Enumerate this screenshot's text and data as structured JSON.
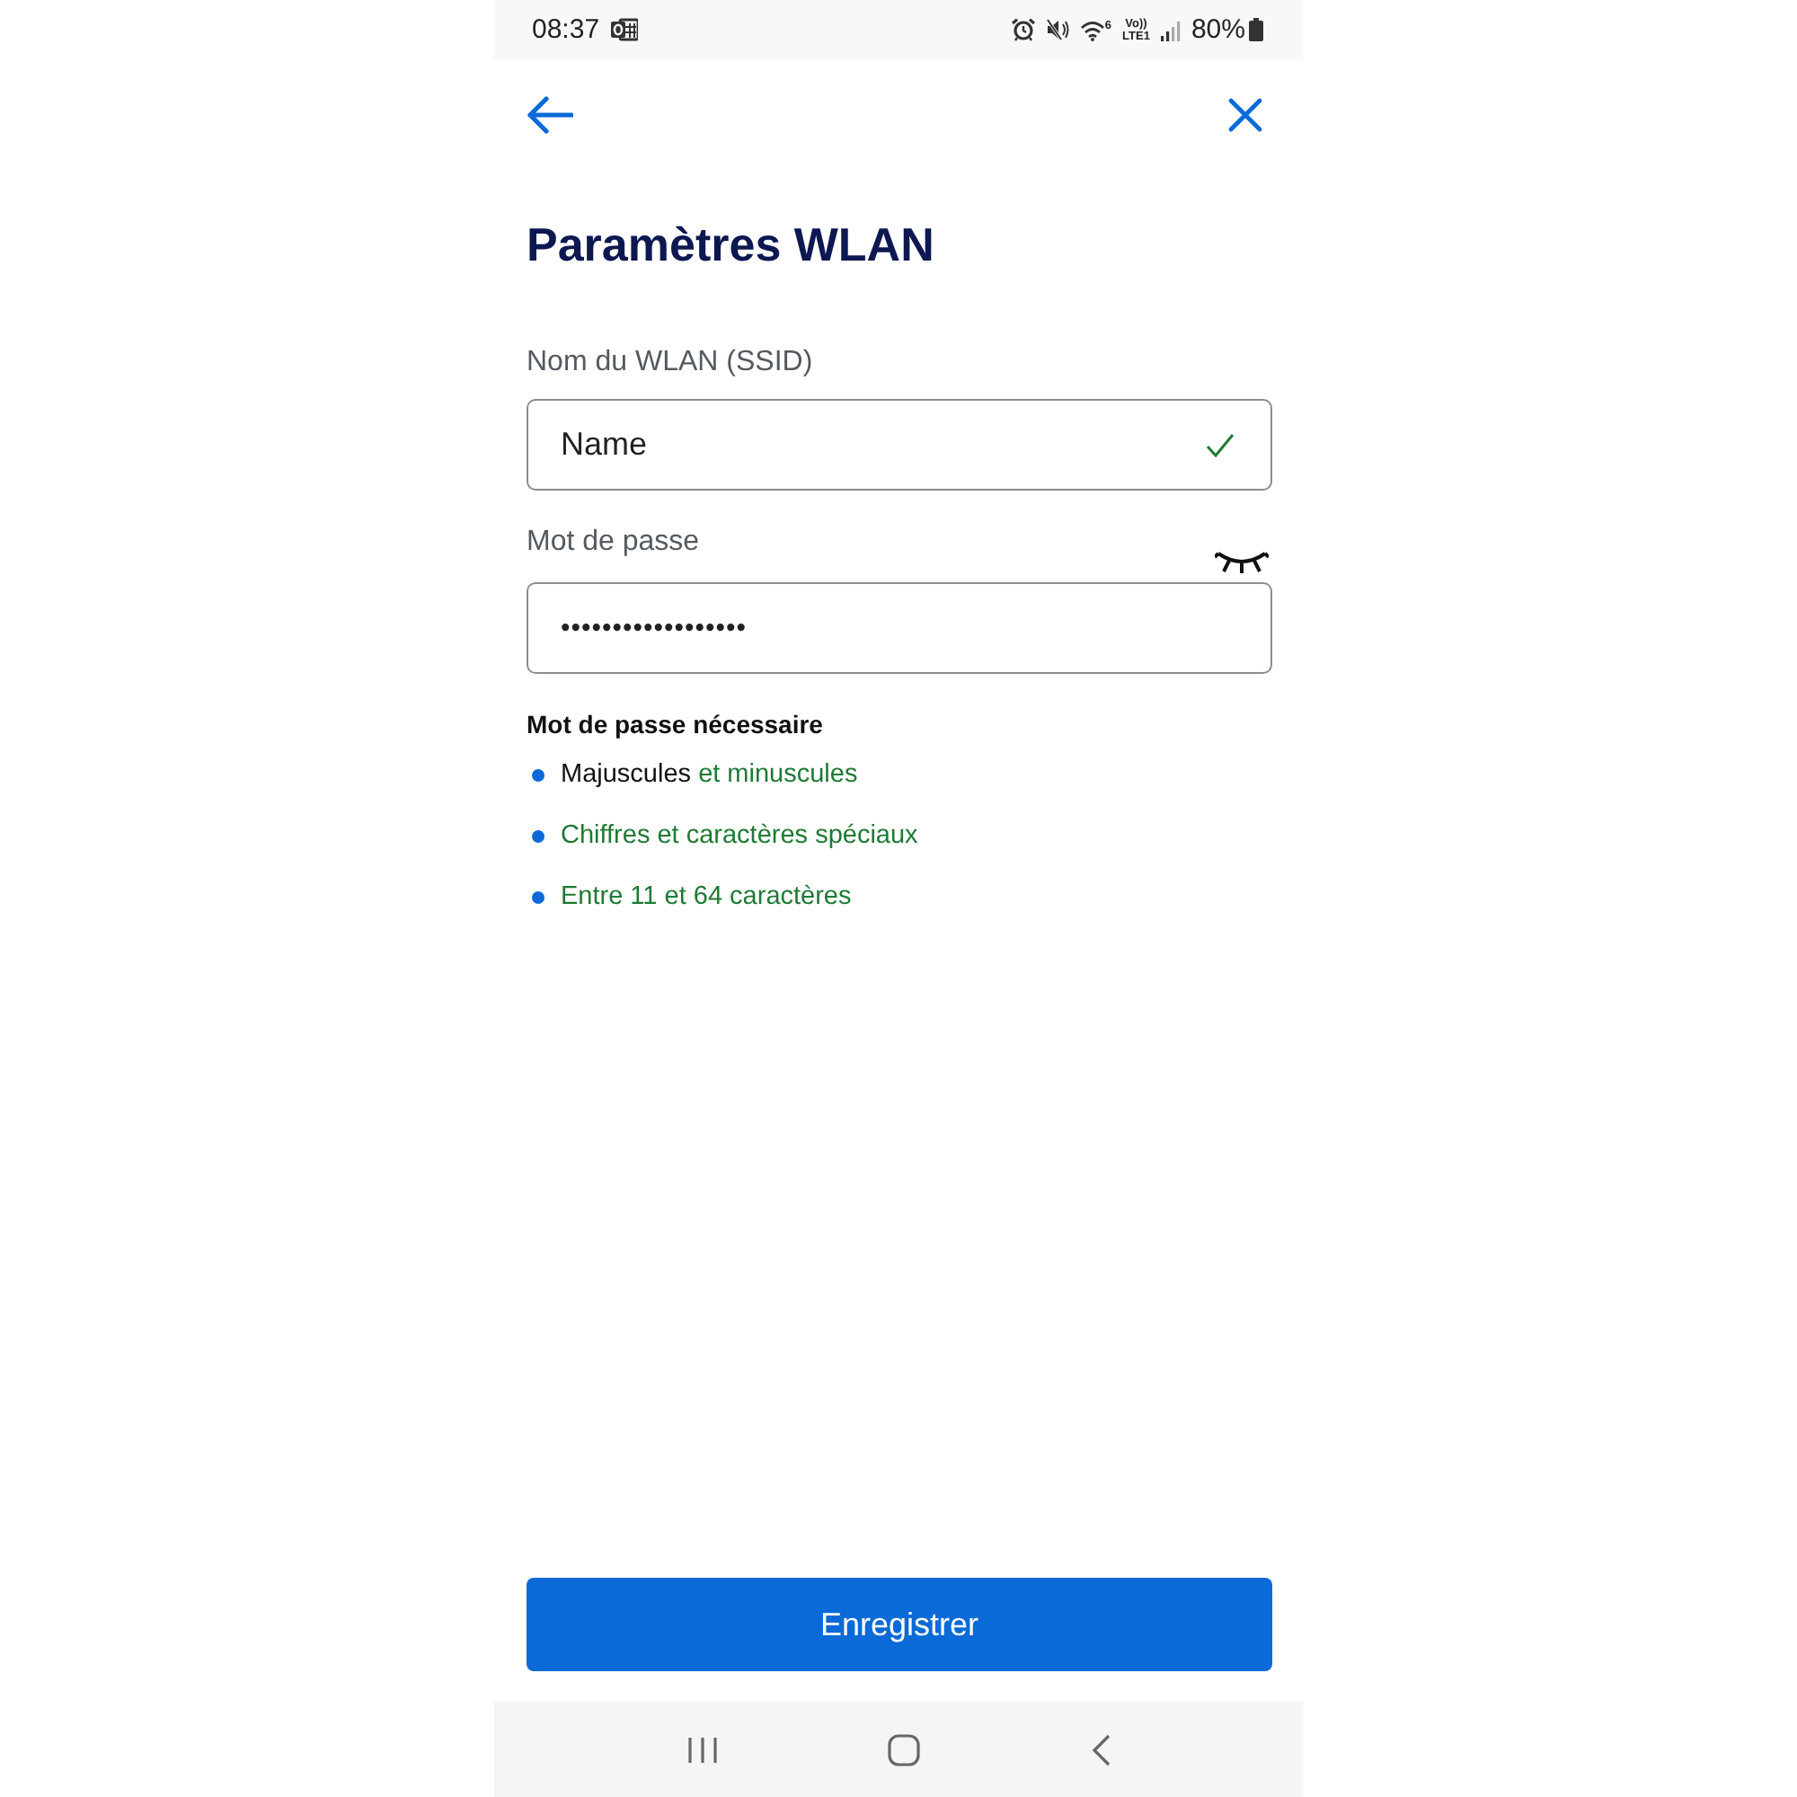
{
  "status_bar": {
    "time": "08:37",
    "wifi_label": "6",
    "network_top": "Vo))",
    "network_bottom": "LTE1",
    "battery": "80%"
  },
  "title": "Paramètres WLAN",
  "fields": [
    {
      "kind": "text",
      "label": "Nom du WLAN (SSID)",
      "value": "Name",
      "valid": true
    },
    {
      "kind": "password",
      "label": "Mot de passe",
      "value": "••••••••••••••••••",
      "valid": false
    }
  ],
  "requirements": {
    "title": "Mot de passe nécessaire",
    "rules": [
      {
        "parts": [
          {
            "text": "Majuscules",
            "met": false
          },
          {
            "text": "et minuscules",
            "met": true
          }
        ]
      },
      {
        "parts": [
          {
            "text": "Chiffres et caractères spéciaux",
            "met": true
          }
        ]
      },
      {
        "parts": [
          {
            "text": "Entre 11 et 64 caractères",
            "met": true
          }
        ]
      }
    ]
  },
  "save_button": "Enregistrer"
}
